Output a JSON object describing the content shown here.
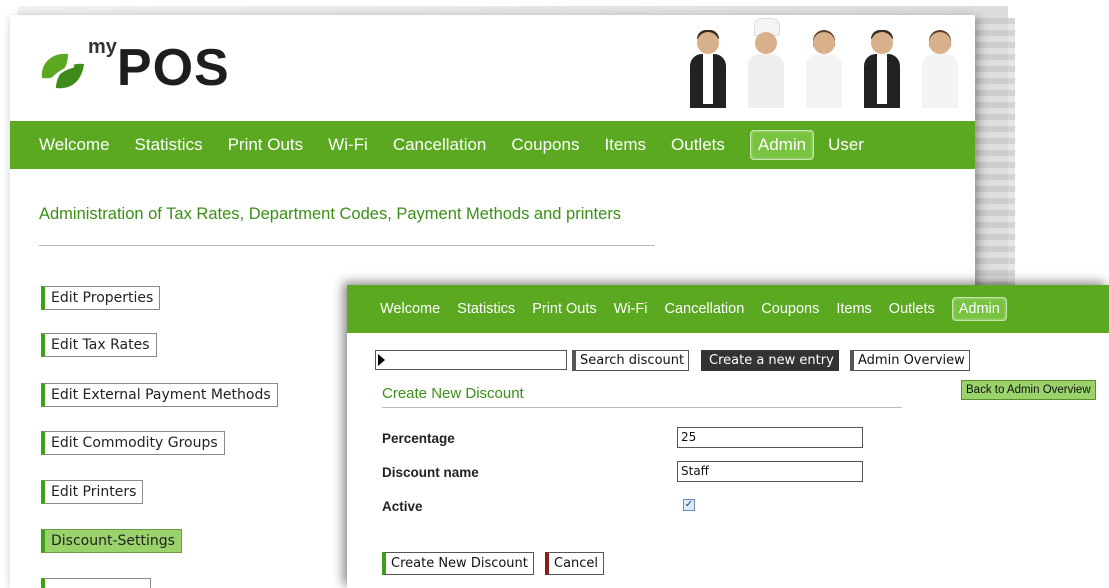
{
  "brand": {
    "my": "my",
    "name": "POS",
    "leaf_color": "#5aa920"
  },
  "nav": {
    "items": [
      "Welcome",
      "Statistics",
      "Print Outs",
      "Wi-Fi",
      "Cancellation",
      "Coupons",
      "Items",
      "Outlets",
      "Admin",
      "User"
    ],
    "active": "Admin",
    "color": "#5aa920"
  },
  "admin": {
    "title": "Administration of Tax Rates, Department Codes, Payment Methods and printers",
    "menu": [
      "Edit Properties",
      "Edit Tax Rates",
      "Edit External Payment Methods",
      "Edit Commodity Groups",
      "Edit Printers",
      "Discount-Settings"
    ],
    "active_menu": "Discount-Settings"
  },
  "overlay": {
    "nav_items": [
      "Welcome",
      "Statistics",
      "Print Outs",
      "Wi-Fi",
      "Cancellation",
      "Coupons",
      "Items",
      "Outlets",
      "Admin"
    ],
    "search_placeholder": "",
    "buttons": {
      "search": "Search discount",
      "create_entry": "Create a new entry",
      "admin_overview": "Admin Overview"
    },
    "tooltip": "Back to Admin Overview",
    "form": {
      "title": "Create New Discount",
      "percentage_label": "Percentage",
      "percentage_value": "25",
      "name_label": "Discount name",
      "name_value": "Staff",
      "active_label": "Active",
      "active_checked": true,
      "submit_label": "Create New Discount",
      "cancel_label": "Cancel"
    }
  }
}
